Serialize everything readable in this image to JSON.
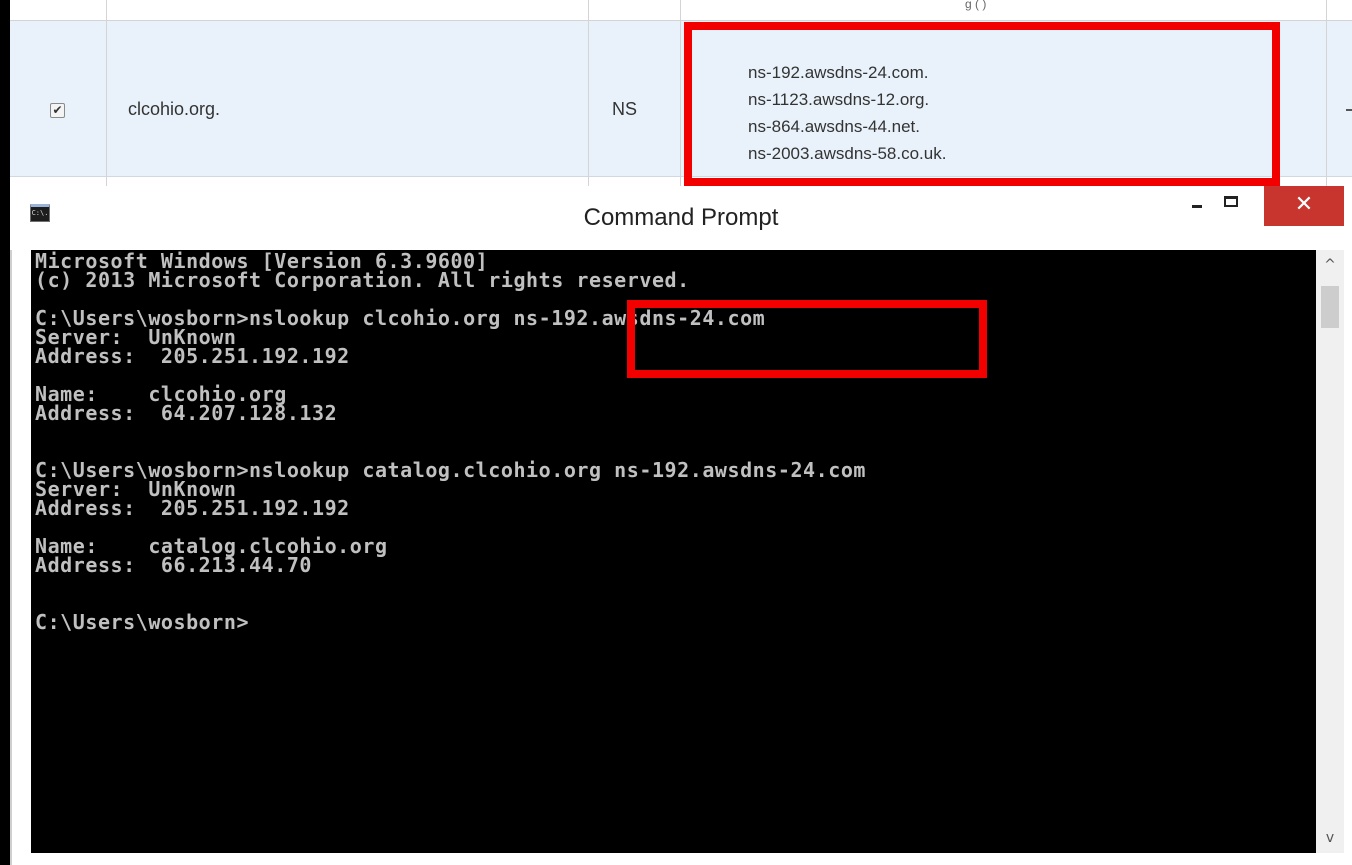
{
  "dns_table": {
    "previous_row_fragment": "g (  )",
    "record": {
      "checked": true,
      "checkbox_glyph": "✔",
      "name": "clcohio.org.",
      "type": "NS",
      "values": [
        "ns-192.awsdns-24.com.",
        "ns-1123.awsdns-12.org.",
        "ns-864.awsdns-44.net.",
        "ns-2003.awsdns-58.co.uk."
      ]
    }
  },
  "cmd_window": {
    "title": "Command Prompt",
    "icon_label": "C:\\.",
    "close_glyph": "✕",
    "console_lines": [
      "Microsoft Windows [Version 6.3.9600]",
      "(c) 2013 Microsoft Corporation. All rights reserved.",
      "",
      "C:\\Users\\wosborn>nslookup clcohio.org ns-192.awsdns-24.com",
      "Server:  UnKnown",
      "Address:  205.251.192.192",
      "",
      "Name:    clcohio.org",
      "Address:  64.207.128.132",
      "",
      "",
      "C:\\Users\\wosborn>nslookup catalog.clcohio.org ns-192.awsdns-24.com",
      "Server:  UnKnown",
      "Address:  205.251.192.192",
      "",
      "Name:    catalog.clcohio.org",
      "Address:  66.213.44.70",
      "",
      "",
      "C:\\Users\\wosborn>"
    ],
    "scroll_up_glyph": "^",
    "scroll_down_glyph": "v"
  },
  "colors": {
    "highlight": "#f20000",
    "selected_row": "#e9f2fb",
    "close_button": "#c7352e",
    "console_bg": "#000000",
    "console_text": "#c0c0c0"
  }
}
